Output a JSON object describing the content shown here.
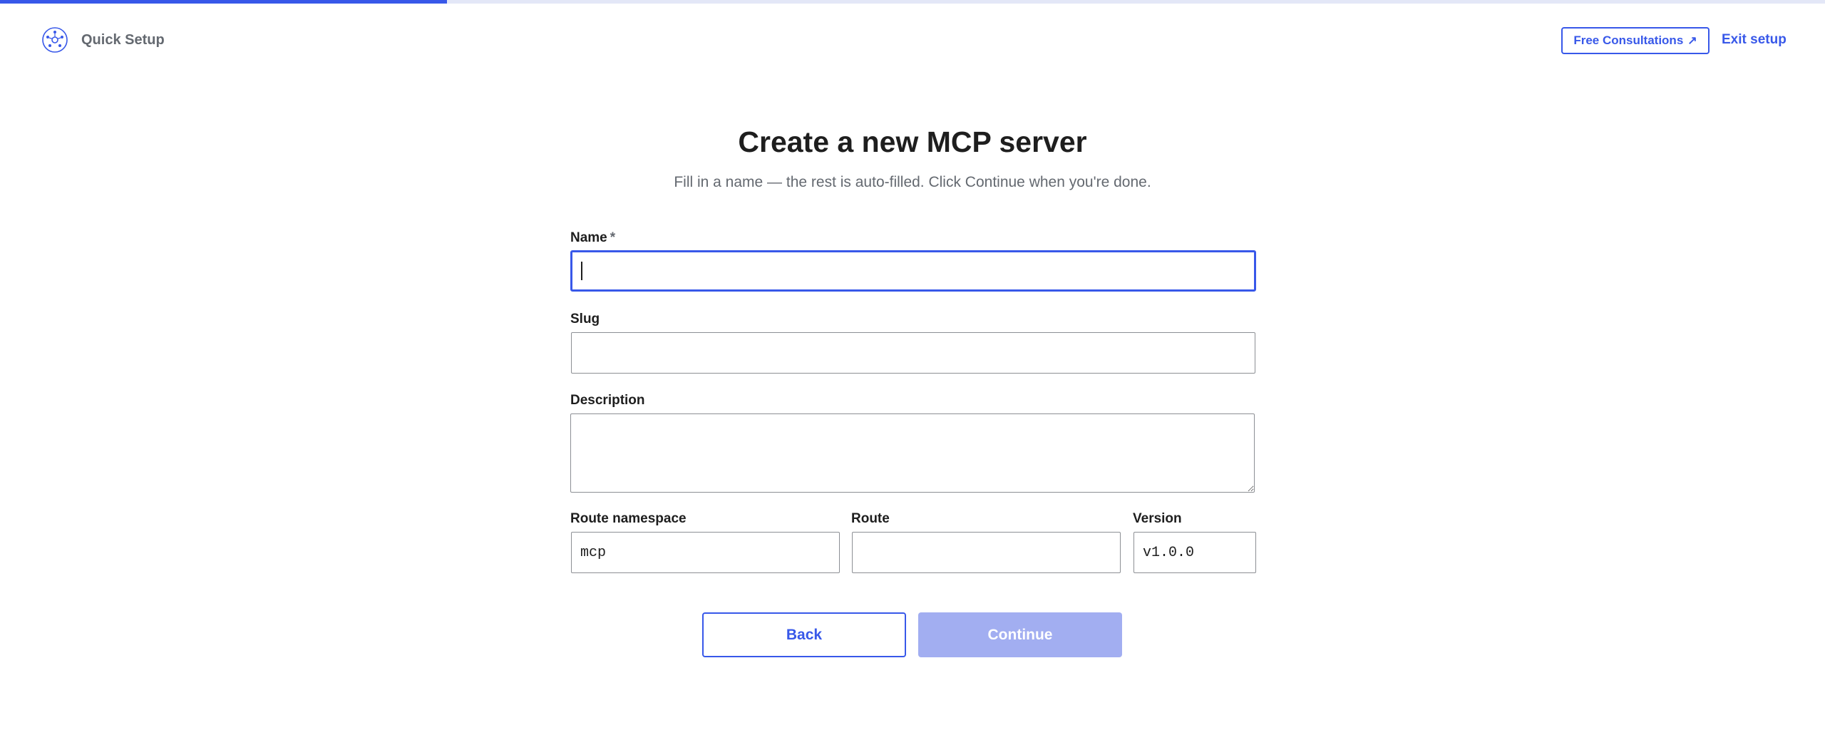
{
  "progress": {
    "fraction": 0.245,
    "fill_color": "#3858e9",
    "track_color": "#e3e7f7"
  },
  "header": {
    "title": "Quick Setup",
    "logo_icon": "network-hub-icon",
    "consult_label": "Free Consultations",
    "consult_icon": "external-arrow-icon",
    "consult_arrow": "↗",
    "exit_label": "Exit setup"
  },
  "main": {
    "title": "Create a new MCP server",
    "subtitle": "Fill in a name — the rest is auto-filled. Click Continue when you're done."
  },
  "form": {
    "name": {
      "label": "Name",
      "required_mark": "*",
      "value": ""
    },
    "slug": {
      "label": "Slug",
      "value": ""
    },
    "description": {
      "label": "Description",
      "value": ""
    },
    "route_namespace": {
      "label": "Route namespace",
      "value": "mcp"
    },
    "route": {
      "label": "Route",
      "value": ""
    },
    "version": {
      "label": "Version",
      "value": "v1.0.0"
    }
  },
  "actions": {
    "back_label": "Back",
    "continue_label": "Continue"
  },
  "colors": {
    "accent": "#3858e9",
    "continue_disabled": "#a2aef1"
  }
}
